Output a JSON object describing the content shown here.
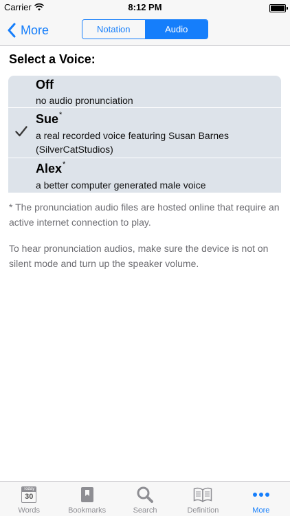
{
  "status_bar": {
    "carrier": "Carrier",
    "time": "8:12 PM"
  },
  "nav": {
    "back_label": "More",
    "segments": [
      {
        "label": "Notation",
        "selected": false
      },
      {
        "label": "Audio",
        "selected": true
      }
    ]
  },
  "section_title": "Select a Voice:",
  "voices": [
    {
      "name": "Off",
      "asterisk": "",
      "description": "no audio pronunciation",
      "selected": false
    },
    {
      "name": "Sue",
      "asterisk": "*",
      "description": "a real recorded voice featuring Susan Barnes (SilverCatStudios)",
      "selected": true
    },
    {
      "name": "Alex",
      "asterisk": "*",
      "description": "a better computer generated male voice",
      "selected": false
    }
  ],
  "notes": [
    "* The pronunciation audio files are hosted online that require an active internet connection to play.",
    "To hear pronunciation audios, make sure the device is not on silent mode and turn up the speaker volume."
  ],
  "tab_bar": {
    "today_icon": {
      "header": "Today",
      "day": "30"
    },
    "tabs": [
      {
        "label": "Words",
        "icon": "calendar-today-icon",
        "active": false
      },
      {
        "label": "Bookmarks",
        "icon": "bookmark-icon",
        "active": false
      },
      {
        "label": "Search",
        "icon": "search-icon",
        "active": false
      },
      {
        "label": "Definition",
        "icon": "open-book-icon",
        "active": false
      },
      {
        "label": "More",
        "icon": "more-dots-icon",
        "active": true
      }
    ]
  },
  "colors": {
    "accent": "#157efb",
    "list_background": "#dde3ea",
    "bar_background": "#f7f7f7",
    "tab_inactive": "#8e8e93"
  }
}
